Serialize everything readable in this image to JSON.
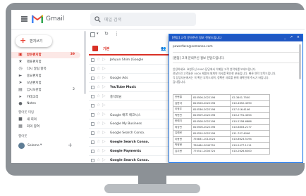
{
  "app": {
    "name": "Gmail"
  },
  "search": {
    "placeholder": "메일 검색"
  },
  "sidebar": {
    "compose_label": "편지쓰기",
    "items": [
      {
        "label": "받은편지함",
        "count": "39",
        "icon": "inbox-icon",
        "active": true
      },
      {
        "label": "별표편지함",
        "count": "",
        "icon": "star-icon"
      },
      {
        "label": "다시 알림 항목",
        "count": "",
        "icon": "clock-icon"
      },
      {
        "label": "중요편지함",
        "count": "",
        "icon": "important-icon"
      },
      {
        "label": "보낸편지함",
        "count": "",
        "icon": "send-icon"
      },
      {
        "label": "임시보관함",
        "count": "2",
        "icon": "draft-icon"
      },
      {
        "label": "카테고리",
        "count": "",
        "icon": "tag-icon"
      },
      {
        "label": "Notes",
        "count": "",
        "icon": "label-icon"
      }
    ],
    "meet_section": "행아웃 미팅",
    "meet_items": [
      {
        "label": "새 회의",
        "icon": "video-icon"
      },
      {
        "label": "회의 참여",
        "icon": "keyboard-icon"
      }
    ],
    "hangouts_section": "행아웃",
    "account_name": "Solomo",
    "account_caret": "▾",
    "account_plus": "+"
  },
  "list": {
    "primary_tab": "기본",
    "rows": [
      {
        "sender": "Jehyun Shim (Google",
        "unread": false
      },
      {
        "sender": "",
        "unread": false
      },
      {
        "sender": "Google Ads",
        "unread": false
      },
      {
        "sender": "YouTube Music",
        "unread": true
      },
      {
        "sender": "홍석희님",
        "unread": false
      },
      {
        "sender": "",
        "unread": false
      },
      {
        "sender": "Google 애즈 에코시스",
        "unread": false
      },
      {
        "sender": "Google My Business",
        "unread": false
      },
      {
        "sender": "Google Search Conso.",
        "unread": false
      },
      {
        "sender": "Google Search Conso.",
        "unread": true
      },
      {
        "sender": "Google Payments",
        "unread": true
      },
      {
        "sender": "Google Search Conso.",
        "unread": true
      }
    ]
  },
  "popup": {
    "title": "[랜덤] 고객 문의주신 정보 전달드립니다",
    "controls": "_ ↗ ×",
    "from": "powerface@somansa.com",
    "subject": "[랜덤] 고객 문의주신 정보 전달드립니다.",
    "body_lines": [
      "안녕하세요. 요청주신 0000 담당에서 이메일 고객 연락처를 보내드립니다.",
      "전달드린 고객들은 0000 제품에 재계약 의사를 확인한 분들입니다. 빠른 연락 부탁드립니다.",
      "각 담당자분께서는 꼭 확인 부탁드리며, 정확한 자료를 위해 재확인해 주시기 바랍니다.",
      "감사합니다."
    ],
    "table": [
      [
        "안현철",
        "810506-2022198",
        "02-3401-7500"
      ],
      [
        "김한아",
        "810526-2022198",
        "010-4652-4590"
      ],
      [
        "이정우",
        "810536-2022198",
        "017-016-4146"
      ],
      [
        "박현민",
        "810509-2022198",
        "010-2791-4054"
      ],
      [
        "한예지",
        "810508-2022198",
        "010-2258-6886"
      ],
      [
        "최성민",
        "810506-2022198",
        "010-6803-2177"
      ],
      [
        "유예린",
        "810520-2022198",
        "011-707-4046"
      ],
      [
        "이동현",
        "750831-1012024",
        "010-8623-5194"
      ],
      [
        "박정현",
        "780464-2040759",
        "010-2477-1111"
      ],
      [
        "김지현",
        "770511-2000724",
        "010-2626-6300"
      ]
    ]
  }
}
